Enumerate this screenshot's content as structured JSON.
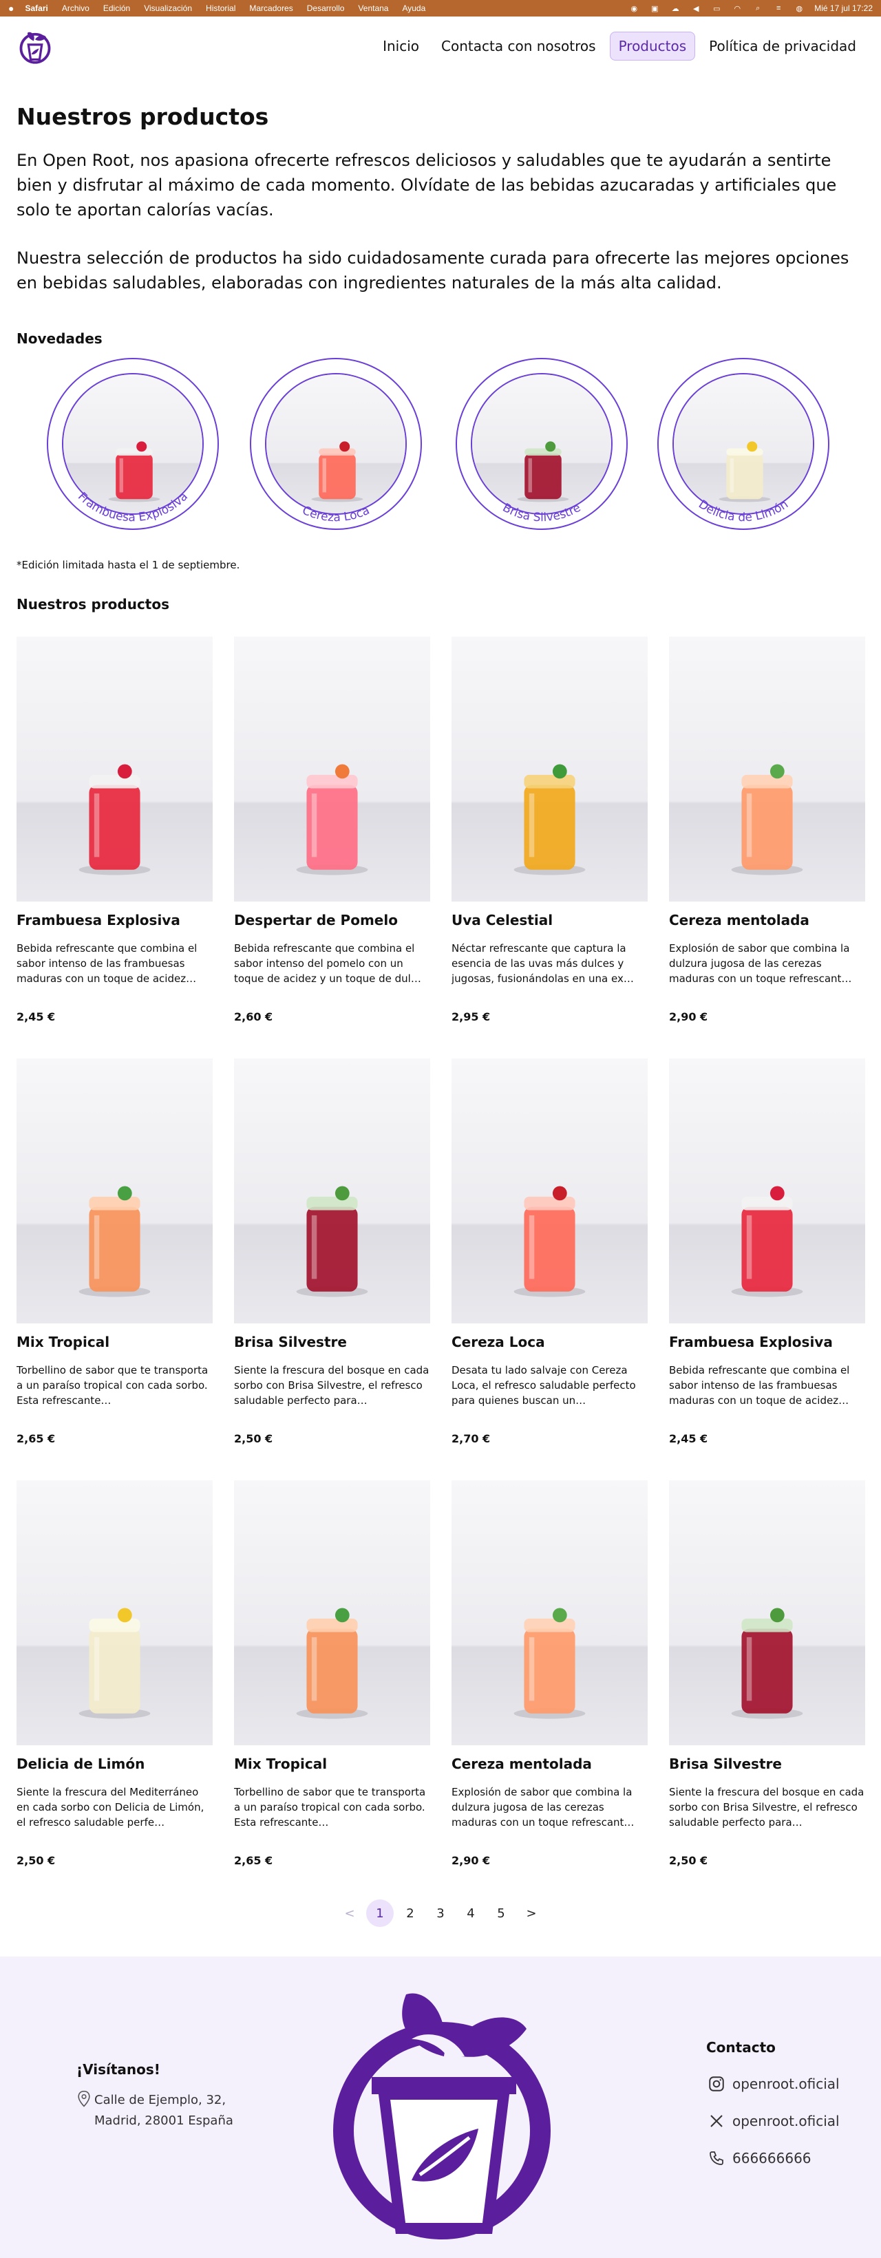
{
  "menubar": {
    "app": "Safari",
    "items": [
      "Archivo",
      "Edición",
      "Visualización",
      "Historial",
      "Marcadores",
      "Desarrollo",
      "Ventana",
      "Ayuda"
    ],
    "datetime": "Mié 17 jul  17:22"
  },
  "nav": {
    "items": [
      "Inicio",
      "Contacta con nosotros",
      "Productos",
      "Política de privacidad"
    ],
    "active": "Productos"
  },
  "page": {
    "title": "Nuestros productos",
    "intro1": "En Open Root, nos apasiona ofrecerte refrescos deliciosos y saludables que te ayudarán a sentirte bien y disfrutar al máximo de cada momento. Olvídate de las bebidas azucaradas y artificiales que solo te aportan calorías vacías.",
    "intro2": "Nuestra selección de productos ha sido cuidadosamente curada para ofrecerte las mejores opciones en bebidas saludables, elaboradas con ingredientes naturales de la más alta calidad.",
    "novedades_title": "Novedades",
    "novedades": [
      "Frambuesa Explosiva",
      "Cereza Loca",
      "Brisa Silvestre",
      "Delicia de Limón"
    ],
    "note": "*Edición limitada hasta el 1 de septiembre.",
    "productos_title": "Nuestros productos"
  },
  "products": [
    {
      "name": "Frambuesa Explosiva",
      "desc": "Bebida refrescante que combina el sabor intenso de las frambuesas maduras con un toque de acidez…",
      "price": "2,45 €",
      "drink": "red"
    },
    {
      "name": "Despertar de Pomelo",
      "desc": "Bebida refrescante que combina el sabor intenso del pomelo con un toque de acidez y un toque de dul…",
      "price": "2,60 €",
      "drink": "pink"
    },
    {
      "name": "Uva Celestial",
      "desc": "Néctar refrescante que captura la esencia de las uvas más dulces y jugosas, fusionándolas en una ex…",
      "price": "2,95 €",
      "drink": "amber"
    },
    {
      "name": "Cereza mentolada",
      "desc": "Explosión de sabor que combina la dulzura jugosa de las cerezas maduras con un toque refrescant…",
      "price": "2,90 €",
      "drink": "peach"
    },
    {
      "name": "Mix Tropical",
      "desc": "Torbellino de sabor que te transporta a un paraíso tropical con cada sorbo. Esta refrescante…",
      "price": "2,65 €",
      "drink": "orange"
    },
    {
      "name": "Brisa Silvestre",
      "desc": "Siente la frescura del bosque en cada sorbo con Brisa Silvestre, el refresco saludable perfecto para…",
      "price": "2,50 €",
      "drink": "berry"
    },
    {
      "name": "Cereza Loca",
      "desc": "Desata tu lado salvaje con Cereza Loca, el refresco saludable perfecto para quienes buscan un…",
      "price": "2,70 €",
      "drink": "cherry"
    },
    {
      "name": "Frambuesa Explosiva",
      "desc": "Bebida refrescante que combina el sabor intenso de las frambuesas maduras con un toque de acidez…",
      "price": "2,45 €",
      "drink": "red"
    },
    {
      "name": "Delicia de Limón",
      "desc": "Siente la frescura del Mediterráneo en cada sorbo con Delicia de Limón, el refresco saludable perfe…",
      "price": "2,50 €",
      "drink": "lemon"
    },
    {
      "name": "Mix Tropical",
      "desc": "Torbellino de sabor que te transporta a un paraíso tropical con cada sorbo. Esta refrescante…",
      "price": "2,65 €",
      "drink": "orange"
    },
    {
      "name": "Cereza mentolada",
      "desc": "Explosión de sabor que combina la dulzura jugosa de las cerezas maduras con un toque refrescant…",
      "price": "2,90 €",
      "drink": "peach"
    },
    {
      "name": "Brisa Silvestre",
      "desc": "Siente la frescura del bosque en cada sorbo con Brisa Silvestre, el refresco saludable perfecto para…",
      "price": "2,50 €",
      "drink": "berry"
    }
  ],
  "pagination": {
    "prev": "<",
    "pages": [
      "1",
      "2",
      "3",
      "4",
      "5"
    ],
    "next": ">",
    "current": "1"
  },
  "footer": {
    "greeting": "¡Visítanos!",
    "address": "Calle de Ejemplo, 32, Madrid, 28001 España",
    "contact_title": "Contacto",
    "instagram": "openroot.oficial",
    "x": "openroot.oficial",
    "phone": "666666666"
  },
  "colors": {
    "accent": "#6a3fd6",
    "brand": "#5b1f9e",
    "nav_active_bg": "#ece2fb",
    "footer_bg": "#f4f0fc"
  }
}
